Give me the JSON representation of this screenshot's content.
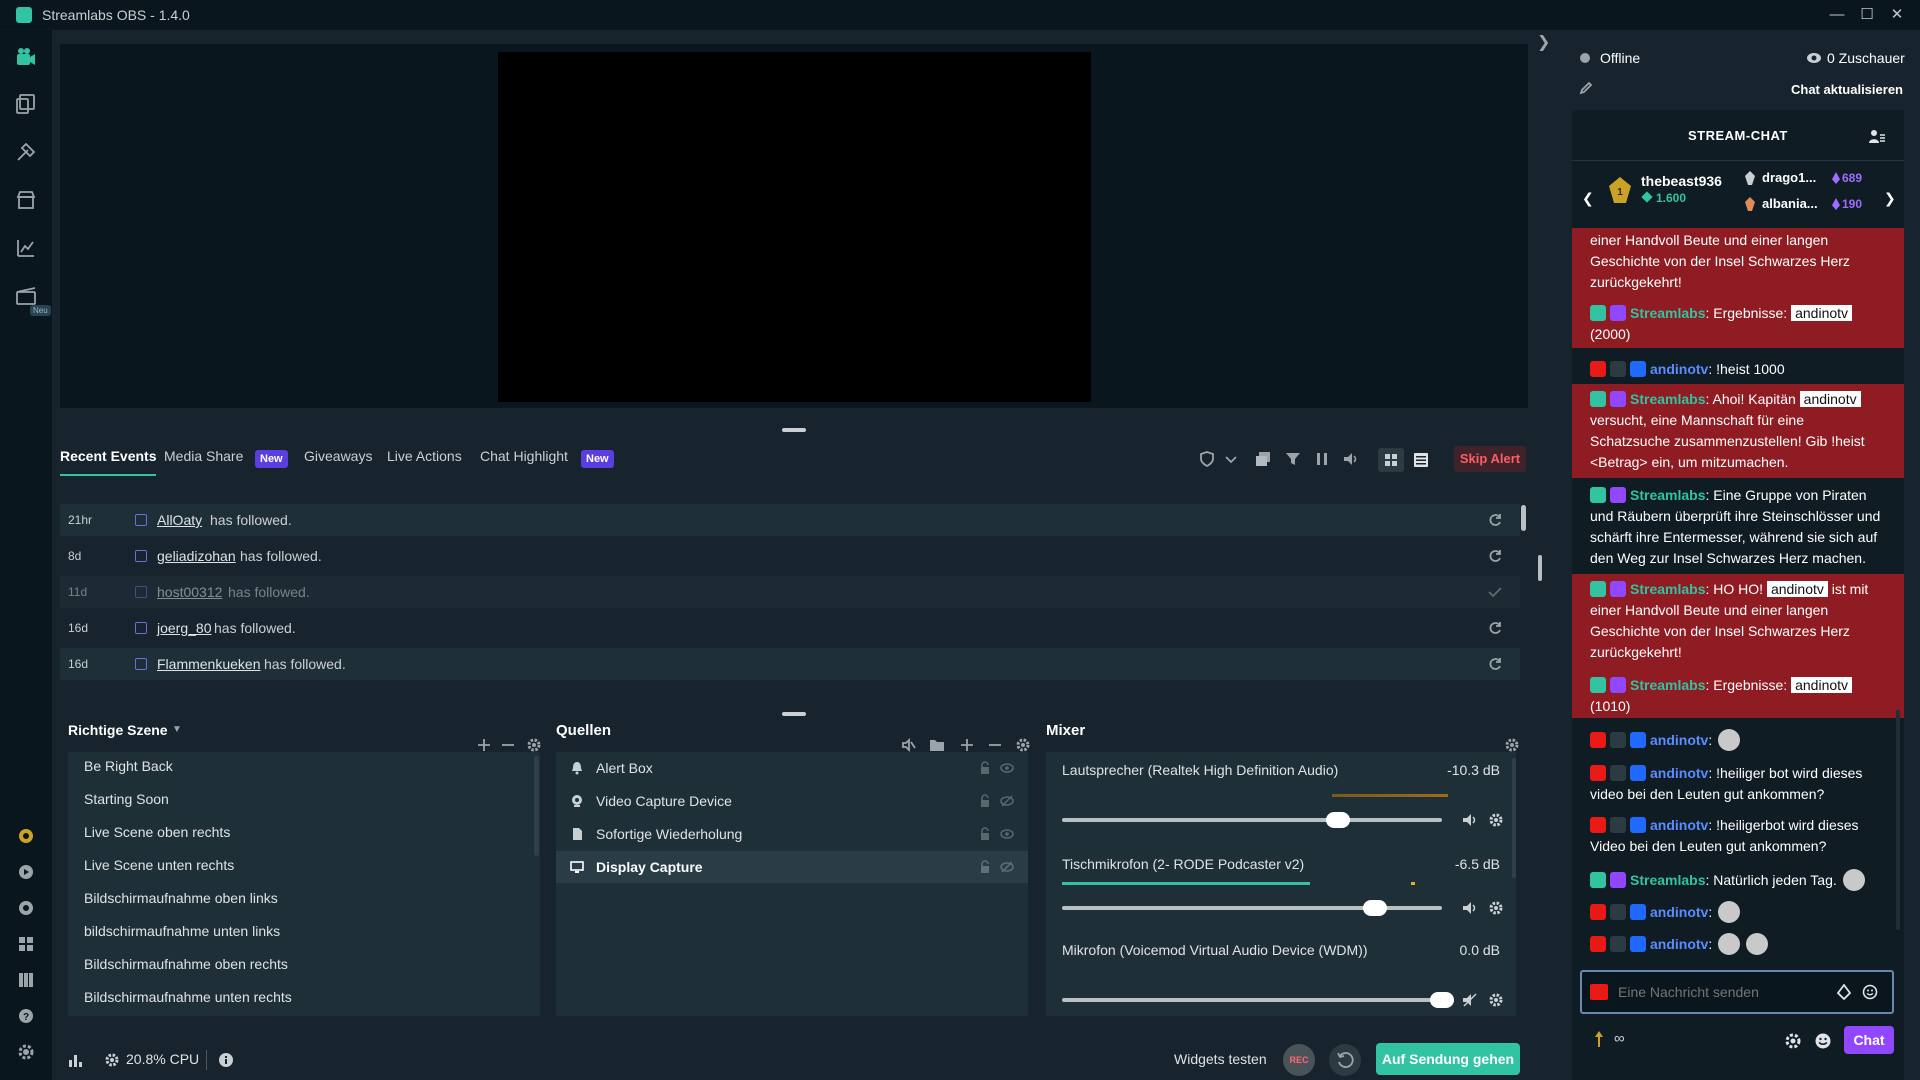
{
  "window": {
    "title": "Streamlabs OBS - 1.4.0"
  },
  "sidebar": {
    "new_badge": "Neu"
  },
  "tabs": {
    "recent_events": "Recent Events",
    "media_share": "Media Share",
    "giveaways": "Giveaways",
    "live_actions": "Live Actions",
    "chat_highlight": "Chat Highlight",
    "new_badge": "New",
    "skip_alert": "Skip Alert"
  },
  "events": [
    {
      "time": "21hr",
      "user": "AllOaty",
      "text": "has followed."
    },
    {
      "time": "8d",
      "user": "geliadizohan",
      "text": "has followed."
    },
    {
      "time": "11d",
      "user": "host00312",
      "text": "has followed."
    },
    {
      "time": "16d",
      "user": "joerg_80",
      "text": "has followed."
    },
    {
      "time": "16d",
      "user": "Flammenkueken",
      "text": "has followed."
    }
  ],
  "scenes": {
    "title": "Richtige Szene",
    "items": [
      "Be Right Back",
      "Starting Soon",
      "Live Scene oben rechts",
      "Live Scene unten rechts",
      "Bildschirmaufnahme oben links",
      "bildschirmaufnahme unten links",
      "Bildschirmaufnahme oben rechts",
      "Bildschirmaufnahme unten rechts"
    ]
  },
  "sources": {
    "title": "Quellen",
    "items": [
      "Alert Box",
      "Video Capture Device",
      "Sofortige Wiederholung",
      "Display Capture"
    ],
    "selected": "Display Capture"
  },
  "mixer": {
    "title": "Mixer",
    "channels": [
      {
        "name": "Lautsprecher (Realtek High Definition Audio)",
        "db": "-10.3 dB",
        "volume": 0.72
      },
      {
        "name": "Tischmikrofon (2- RODE Podcaster v2)",
        "db": "-6.5 dB",
        "volume": 0.82
      },
      {
        "name": "Mikrofon (Voicemod Virtual Audio Device (WDM))",
        "db": "0.0 dB",
        "volume": 1.0
      }
    ]
  },
  "footer": {
    "cpu": "20.8% CPU",
    "widgets_test": "Widgets testen",
    "rec": "REC",
    "go_live": "Auf Sendung gehen"
  },
  "chat": {
    "status": "Offline",
    "viewers": "0 Zuschauer",
    "refresh": "Chat aktualisieren",
    "header": "STREAM-CHAT",
    "top_user": "thebeast936",
    "top_user_points": "1.600",
    "leader2": "drago1...",
    "leader2_points": "689",
    "leader3": "albania...",
    "leader3_points": "190",
    "input_placeholder": "Eine Nachricht senden",
    "infinite": "∞",
    "send": "Chat",
    "messages": {
      "m0": "einer Handvoll Beute und einer langen Geschichte von der Insel Schwarzes Herz zurückgekehrt!",
      "m1_user": "Streamlabs",
      "m1_text": ": Ergebnisse: ",
      "m1_mention": "andinotv",
      "m1_tail": "(2000)",
      "m2_user": "andinotv",
      "m2_text": ": !heist 1000",
      "m3_user": "Streamlabs",
      "m3_text": ": Ahoi! Kapitän ",
      "m3_mention": "andinotv",
      "m3_tail": "versucht, eine Mannschaft für eine Schatzsuche zusammenzustellen! Gib !heist <Betrag> ein, um mitzumachen.",
      "m4_user": "Streamlabs",
      "m4_text": ": Eine Gruppe von Piraten und Räubern überprüft ihre Steinschlösser und schärft ihre Entermesser, während sie sich auf den Weg zur Insel Schwarzes Herz machen.",
      "m5_user": "Streamlabs",
      "m5_text": ": HO HO! ",
      "m5_mention": "andinotv",
      "m5_tail": " ist mit einer Handvoll Beute und einer langen Geschichte von der Insel Schwarzes Herz zurückgekehrt!",
      "m6_user": "Streamlabs",
      "m6_text": ": Ergebnisse: ",
      "m6_mention": "andinotv",
      "m6_tail": "(1010)",
      "m7_user": "andinotv",
      "m7_text": ":",
      "m8_user": "andinotv",
      "m8_text": ": !heiliger bot wird dieses video bei den Leuten gut ankommen?",
      "m9_user": "andinotv",
      "m9_text": ": !heiligerbot wird dieses Video bei den Leuten gut ankommen?",
      "m10_user": "Streamlabs",
      "m10_text": ": Natürlich jeden Tag.",
      "m11_user": "andinotv",
      "m11_text": ":",
      "m12_user": "andinotv",
      "m12_text": ":"
    }
  }
}
